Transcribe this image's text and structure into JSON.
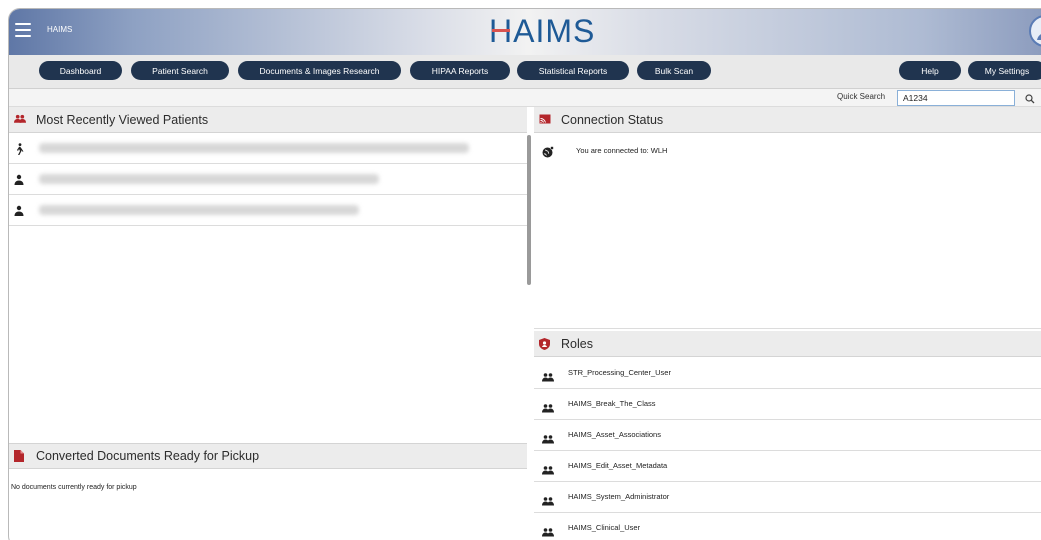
{
  "header": {
    "app_name": "HAIMS",
    "logo_text": "HAIMS"
  },
  "nav": {
    "items": [
      {
        "label": "Dashboard"
      },
      {
        "label": "Patient Search"
      },
      {
        "label": "Documents & Images Research"
      },
      {
        "label": "HIPAA Reports"
      },
      {
        "label": "Statistical Reports"
      },
      {
        "label": "Bulk Scan"
      },
      {
        "label": "Help"
      },
      {
        "label": "My Settings"
      }
    ]
  },
  "quick_search": {
    "label": "Quick Search",
    "value": "A1234"
  },
  "recent_patients": {
    "title": "Most Recently Viewed Patients",
    "rows": [
      {
        "icon": "person-walking-icon"
      },
      {
        "icon": "person-icon"
      },
      {
        "icon": "person-icon"
      }
    ]
  },
  "connection": {
    "title": "Connection Status",
    "message": "You are connected to: WLH"
  },
  "roles": {
    "title": "Roles",
    "items": [
      "STR_Processing_Center_User",
      "HAIMS_Break_The_Class",
      "HAIMS_Asset_Associations",
      "HAIMS_Edit_Asset_Metadata",
      "HAIMS_System_Administrator",
      "HAIMS_Clinical_User"
    ]
  },
  "converted_docs": {
    "title": "Converted Documents Ready for Pickup",
    "empty_message": "No documents currently ready for pickup"
  },
  "colors": {
    "nav_button": "#20344f",
    "accent_red": "#b3262b",
    "logo_blue": "#1e5a96"
  }
}
